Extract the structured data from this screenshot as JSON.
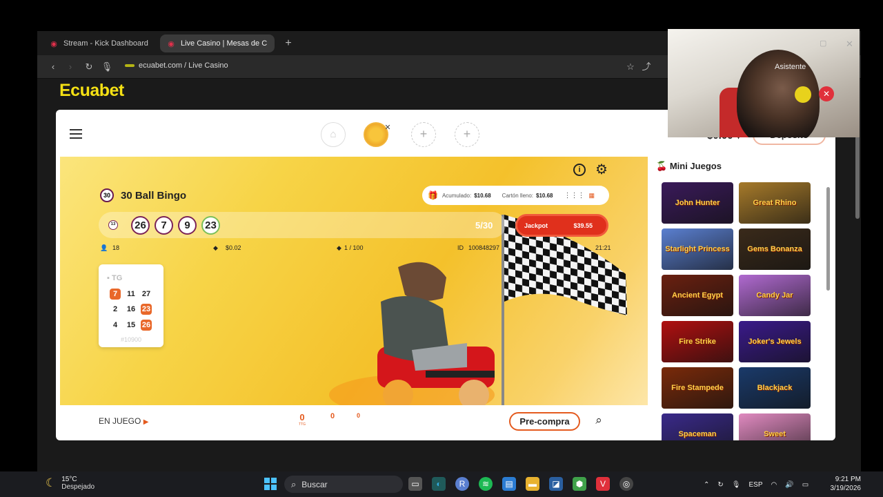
{
  "browser": {
    "tabs": [
      {
        "label": "Stream - Kick Dashboard",
        "active": false
      },
      {
        "label": "Live Casino | Mesas de C",
        "active": true
      }
    ],
    "new_tab": "+",
    "url": "ecuabet.com / Live Casino"
  },
  "site": {
    "logo": "Ecuabet",
    "balance": "$0.00",
    "balance_arrow": "▾",
    "deposit_label": "Depósito"
  },
  "game": {
    "title_badge": "30",
    "title": "30 Ball Bingo",
    "accumulated_label": "Acumulado:",
    "accumulated_value": "$10.68",
    "full_card_label": "Cartón lleno:",
    "full_card_value": "$10.68",
    "small_ball": "13",
    "called_balls": [
      "26",
      "7",
      "9",
      "23"
    ],
    "progress": "5/30",
    "jackpot_label": "Jackpot",
    "jackpot_value": "$39.55",
    "players": "18",
    "price": "$0.02",
    "cards": "1 / 100",
    "id_label": "ID",
    "id_value": "100848297",
    "time": "21:21",
    "card": {
      "tag": "TG",
      "rows": [
        [
          "7",
          "11",
          "27"
        ],
        [
          "2",
          "16",
          "23"
        ],
        [
          "4",
          "15",
          "26"
        ]
      ],
      "hits": [
        "7",
        "23",
        "26"
      ],
      "id": "#10900"
    },
    "status": "EN JUEGO",
    "counters": [
      {
        "value": "0",
        "label": "TTG"
      },
      {
        "value": "0",
        "label": ""
      },
      {
        "value": "0",
        "label": ""
      }
    ],
    "precompra": "Pre-compra"
  },
  "mini_games": {
    "title": "Mini Juegos",
    "tiles": [
      {
        "label": "John Hunter",
        "color": "#3a1a5a"
      },
      {
        "label": "Great Rhino",
        "color": "#a67a2a"
      },
      {
        "label": "Starlight Princess",
        "color": "#5a7fd0"
      },
      {
        "label": "Gems Bonanza",
        "color": "#3a2a1a"
      },
      {
        "label": "Ancient Egypt",
        "color": "#6a2010"
      },
      {
        "label": "Candy Jar",
        "color": "#b06ad0"
      },
      {
        "label": "Fire Strike",
        "color": "#b01010"
      },
      {
        "label": "Joker's Jewels",
        "color": "#3a1a8a"
      },
      {
        "label": "Fire Stampede",
        "color": "#7a2a0a"
      },
      {
        "label": "Blackjack",
        "color": "#1a3a6a"
      },
      {
        "label": "Spaceman",
        "color": "#3a2a8a"
      },
      {
        "label": "Sweet",
        "color": "#e08ac0"
      }
    ]
  },
  "webcam": {
    "label": "Asistente"
  },
  "taskbar": {
    "temperature": "15°C",
    "weather": "Despejado",
    "search_placeholder": "Buscar",
    "language": "ESP",
    "time": "9:21 PM",
    "date": "3/19/2026"
  }
}
